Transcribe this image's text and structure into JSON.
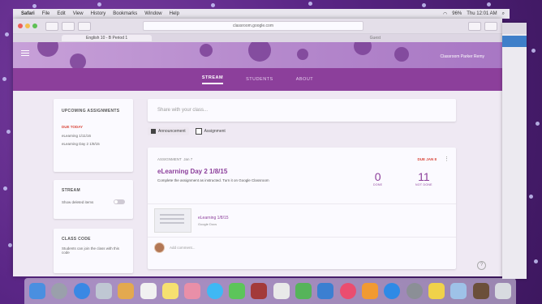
{
  "menubar": {
    "items": [
      "Safari",
      "File",
      "Edit",
      "View",
      "History",
      "Bookmarks",
      "Window",
      "Help"
    ],
    "clock": "Thu 12:01 AM",
    "battery": "96%"
  },
  "browser": {
    "url": "classroom.google.com",
    "tab_title": "English 10 - B Period 1",
    "new_tab": "Guest"
  },
  "classroom": {
    "user": "Classroom Parker Remy",
    "nav": {
      "stream": "STREAM",
      "students": "STUDENTS",
      "about": "ABOUT"
    },
    "upcoming": {
      "title": "UPCOMING ASSIGNMENTS",
      "due_today": "DUE TODAY",
      "items": [
        "eLearning 1/11/16",
        "eLearning Day 2 1/8/15"
      ]
    },
    "stream_box": {
      "title": "STREAM",
      "toggle_label": "Show deleted items"
    },
    "class_code": {
      "title": "CLASS CODE",
      "desc": "Students can join the class with this code"
    },
    "share_placeholder": "Share with your class...",
    "types": {
      "announcement": "Announcement",
      "assignment": "Assignment"
    },
    "assignment": {
      "label": "ASSIGNMENT",
      "date": "Jan 7",
      "due": "DUE JAN 8",
      "title": "eLearning Day 2 1/8/15",
      "description": "Complete the assignment as instructed. Turn it on Google Classroom",
      "done_count": "0",
      "done_label": "DONE",
      "notdone_count": "11",
      "notdone_label": "NOT DONE",
      "attachment_title": "eLearning 1/8/15",
      "attachment_sub": "Google Docs",
      "comment_placeholder": "Add comment..."
    }
  },
  "colors": {
    "accent": "#8c3f9b",
    "due_red": "#d9463a"
  },
  "dock_icons": [
    "finder-icon",
    "launchpad-icon",
    "safari-icon",
    "preview-icon",
    "notes-icon",
    "calendar-icon",
    "stickies-icon",
    "photos-icon",
    "messages-icon",
    "facetime-icon",
    "photo-booth-icon",
    "calendar-alt-icon",
    "numbers-icon",
    "keynote-icon",
    "music-icon",
    "ibooks-icon",
    "app-store-icon",
    "settings-icon",
    "pencil-icon",
    "folder-icon",
    "script-icon",
    "trash-icon"
  ]
}
